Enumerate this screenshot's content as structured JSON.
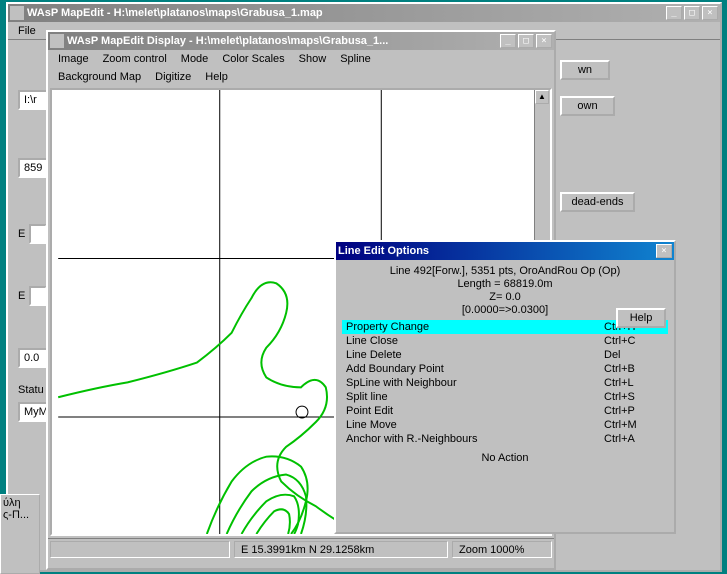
{
  "main": {
    "title": "WAsP MapEdit - H:\\melet\\platanos\\maps\\Grabusa_1.map",
    "menubar": [
      "File"
    ],
    "fields": {
      "pathPrefix": "I:\\r",
      "val859": "859",
      "labelE1": "E",
      "labelE2": "E",
      "val0": "0.0",
      "statusLabel": "Statu",
      "statusVal": "MyM"
    },
    "right": {
      "btn1": "wn",
      "btn2": "own",
      "deadends": "dead-ends"
    }
  },
  "display": {
    "title": "WAsP MapEdit Display - H:\\melet\\platanos\\maps\\Grabusa_1...",
    "menubar1": [
      "Image",
      "Zoom control",
      "Mode",
      "Color Scales",
      "Show",
      "Spline"
    ],
    "menubar2": [
      "Background Map",
      "Digitize",
      "Help"
    ],
    "statusbar": {
      "coord": "E   15.3991km N   29.1258km",
      "zoom": "Zoom 1000%"
    }
  },
  "dialog": {
    "title": "Line Edit Options",
    "info1": "Line 492[Forw.], 5351 pts, OroAndRou Op (Op)",
    "info2": "Length = 68819.0m",
    "info3": "Z=      0.0",
    "info4": "[0.0000=>0.0300]",
    "help": "Help",
    "items": [
      {
        "label": "Property Change",
        "shortcut": "Ctrl+H",
        "selected": true
      },
      {
        "label": "Line Close",
        "shortcut": "Ctrl+C"
      },
      {
        "label": "Line Delete",
        "shortcut": "Del"
      },
      {
        "label": "Add Boundary Point",
        "shortcut": "Ctrl+B"
      },
      {
        "label": "SpLine with Neighbour",
        "shortcut": "Ctrl+L"
      },
      {
        "label": "Split line",
        "shortcut": "Ctrl+S"
      },
      {
        "label": "Point Edit",
        "shortcut": "Ctrl+P"
      },
      {
        "label": "Line Move",
        "shortcut": "Ctrl+M"
      },
      {
        "label": "Anchor with R.-Neighbours",
        "shortcut": "Ctrl+A"
      }
    ],
    "noAction": "No Action"
  },
  "taskbar": {
    "text": "ύλη\nς-Π..."
  },
  "icons": {
    "min": "_",
    "max": "□",
    "close": "×",
    "up": "▲",
    "down": "▼"
  }
}
